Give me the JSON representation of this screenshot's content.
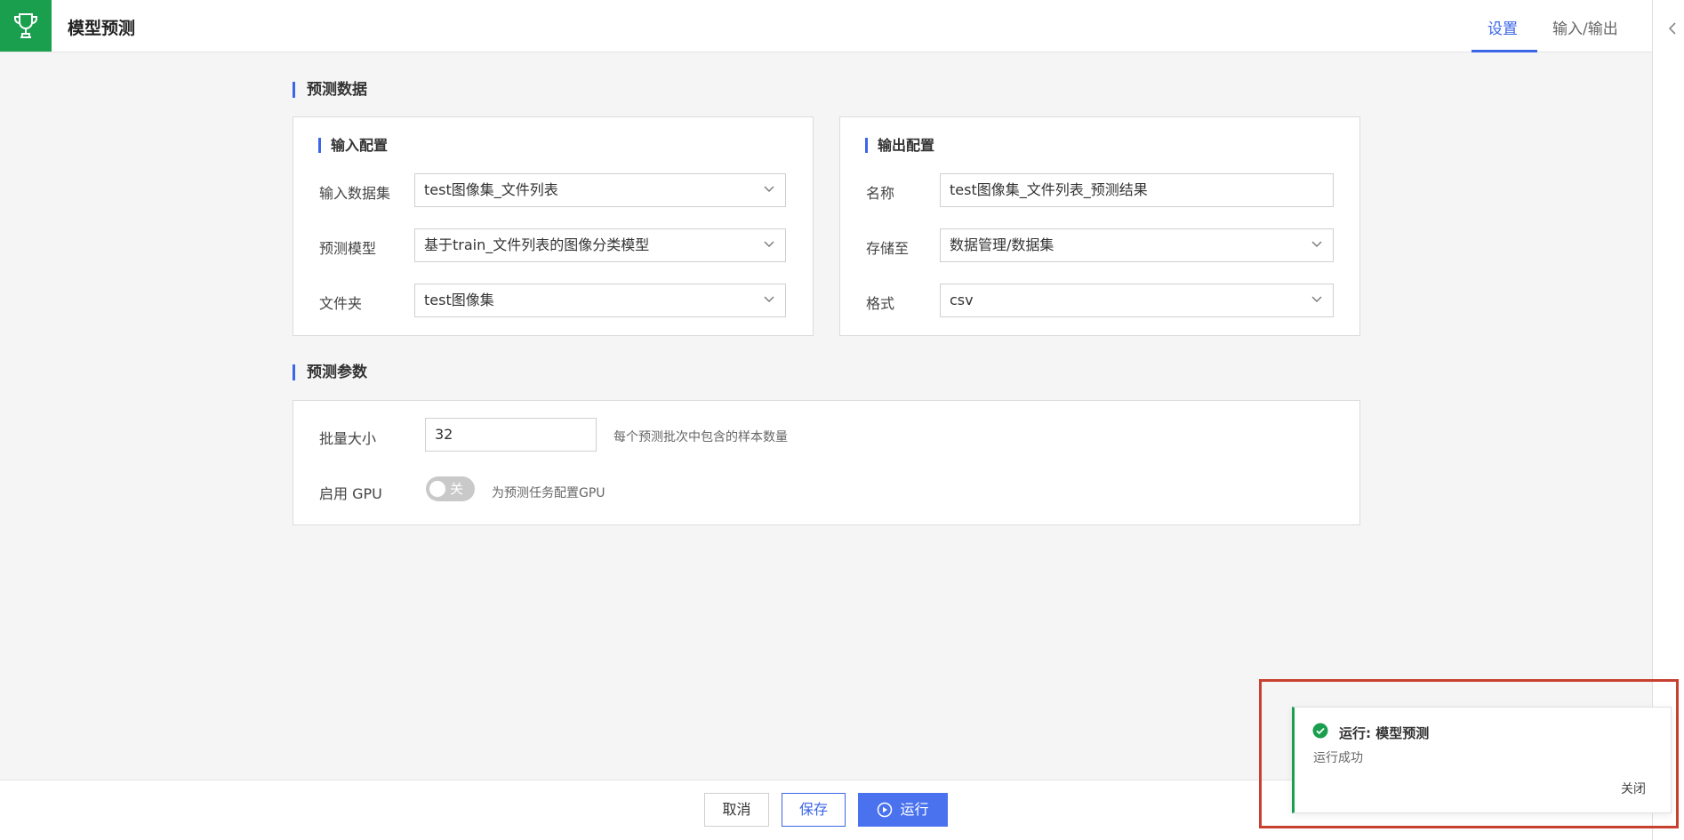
{
  "header": {
    "title": "模型预测",
    "tabs": [
      {
        "label": "设置",
        "active": true
      },
      {
        "label": "输入/输出",
        "active": false
      }
    ],
    "logo_icon": "trophy-icon",
    "brand_color": "#1a9f4f",
    "accent_color": "#3c66e8"
  },
  "predict_data": {
    "title": "预测数据",
    "input_config": {
      "title": "输入配置",
      "dataset_label": "输入数据集",
      "dataset_value": "test图像集_文件列表",
      "model_label": "预测模型",
      "model_value": "基于train_文件列表的图像分类模型",
      "folder_label": "文件夹",
      "folder_value": "test图像集"
    },
    "output_config": {
      "title": "输出配置",
      "name_label": "名称",
      "name_value": "test图像集_文件列表_预测结果",
      "store_label": "存储至",
      "store_value": "数据管理/数据集",
      "format_label": "格式",
      "format_value": "csv"
    }
  },
  "predict_params": {
    "title": "预测参数",
    "batch_label": "批量大小",
    "batch_value": "32",
    "batch_hint": "每个预测批次中包含的样本数量",
    "gpu_label": "启用 GPU",
    "gpu_toggle_text": "关",
    "gpu_enabled": false,
    "gpu_hint": "为预测任务配置GPU"
  },
  "footer": {
    "cancel": "取消",
    "save": "保存",
    "run": "运行"
  },
  "toast": {
    "title": "运行: 模型预测",
    "message": "运行成功",
    "close": "关闭",
    "status_color": "#1a9f4f"
  }
}
